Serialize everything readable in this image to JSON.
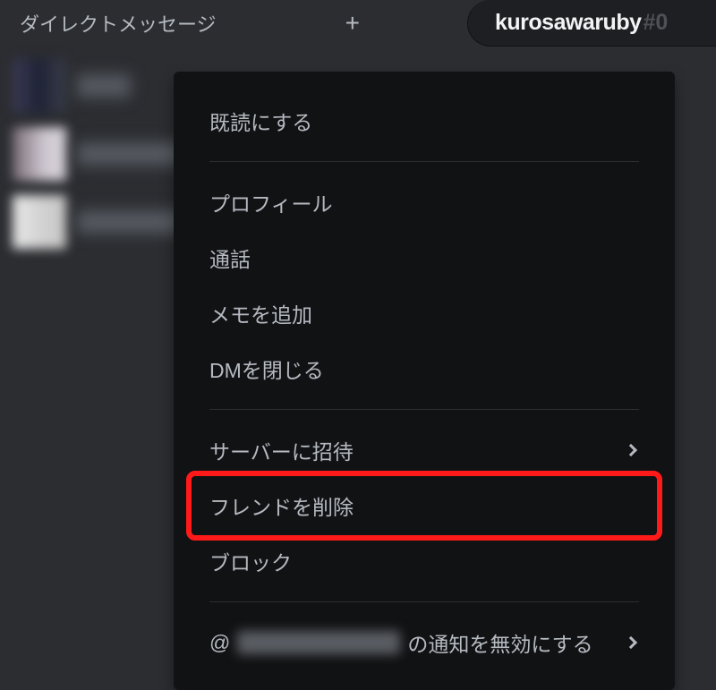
{
  "sidebar": {
    "title": "ダイレクトメッセージ",
    "plus_label": "+"
  },
  "header": {
    "username": "kurosawaruby",
    "tag_prefix": "#0"
  },
  "context_menu": {
    "mark_read": "既読にする",
    "profile": "プロフィール",
    "call": "通話",
    "add_note": "メモを追加",
    "close_dm": "DMを閉じる",
    "invite_server": "サーバーに招待",
    "remove_friend": "フレンドを削除",
    "block": "ブロック",
    "mute_prefix": "@",
    "mute_suffix": "の通知を無効にする"
  }
}
